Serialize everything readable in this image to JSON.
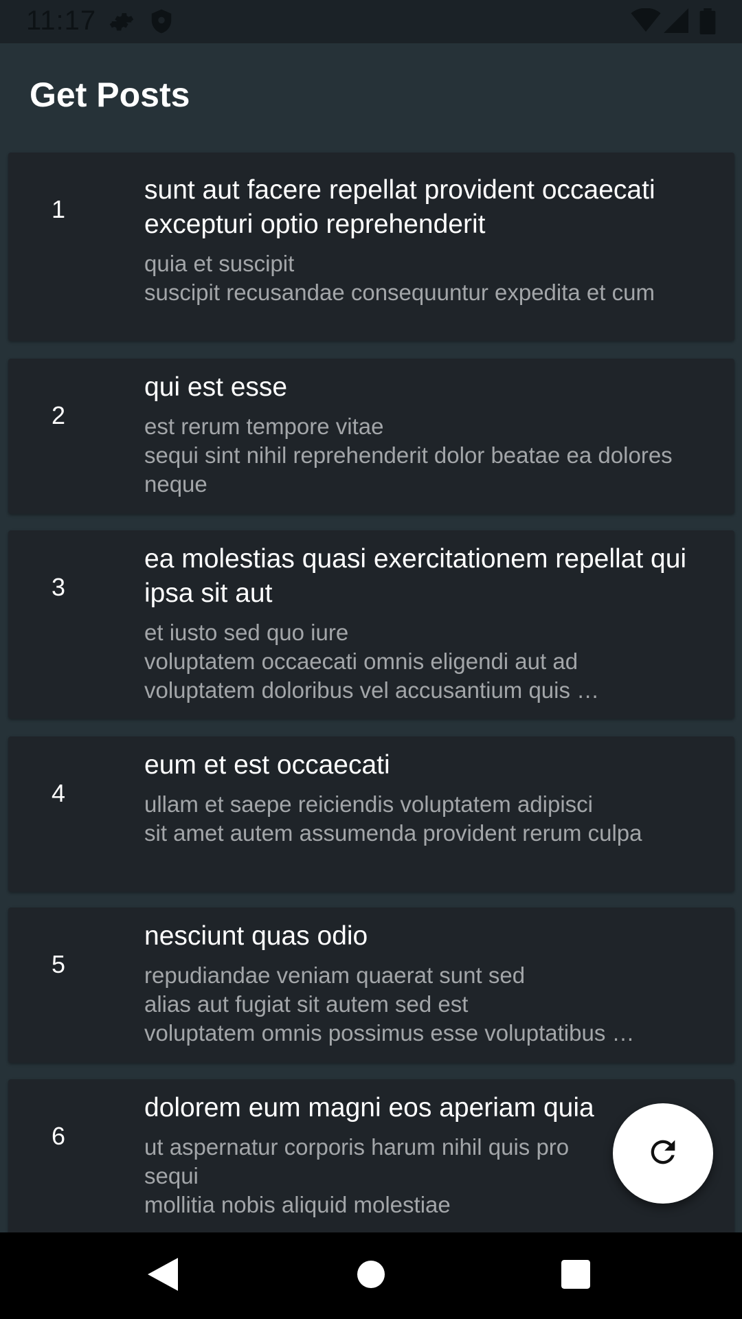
{
  "status_bar": {
    "time": "11:17",
    "icons": [
      "settings-gear-icon",
      "shield-icon",
      "wifi-icon",
      "signal-icon",
      "battery-icon"
    ]
  },
  "app_bar": {
    "title": "Get Posts"
  },
  "posts": [
    {
      "id": "1",
      "title": "sunt aut facere repellat provident occaecati excepturi optio reprehenderit",
      "body": "quia et suscipit\nsuscipit recusandae consequuntur expedita et cum"
    },
    {
      "id": "2",
      "title": "qui est esse",
      "body": "est rerum tempore vitae\nsequi sint nihil reprehenderit dolor beatae ea dolores neque"
    },
    {
      "id": "3",
      "title": "ea molestias quasi exercitationem repellat qui ipsa sit aut",
      "body": "et iusto sed quo iure\nvoluptatem occaecati omnis eligendi aut ad\nvoluptatem doloribus vel accusantium quis …"
    },
    {
      "id": "4",
      "title": "eum et est occaecati",
      "body": "ullam et saepe reiciendis voluptatem adipisci\nsit amet autem assumenda provident rerum culpa"
    },
    {
      "id": "5",
      "title": "nesciunt quas odio",
      "body": "repudiandae veniam quaerat sunt sed\nalias aut fugiat sit autem sed est\nvoluptatem omnis possimus esse voluptatibus …"
    },
    {
      "id": "6",
      "title": "dolorem eum magni eos aperiam quia",
      "body": "ut aspernatur corporis harum nihil quis pro\nsequi\nmollitia nobis aliquid molestiae"
    }
  ],
  "fab": {
    "icon": "refresh-icon"
  },
  "nav_bar": {
    "icons": [
      "back-triangle-icon",
      "home-circle-icon",
      "recents-square-icon"
    ]
  },
  "colors": {
    "background": "#263238",
    "card": "#1f2429",
    "status_bar": "#1b2227",
    "body_text": "#a3a6a9",
    "fab": "#ffffff"
  }
}
